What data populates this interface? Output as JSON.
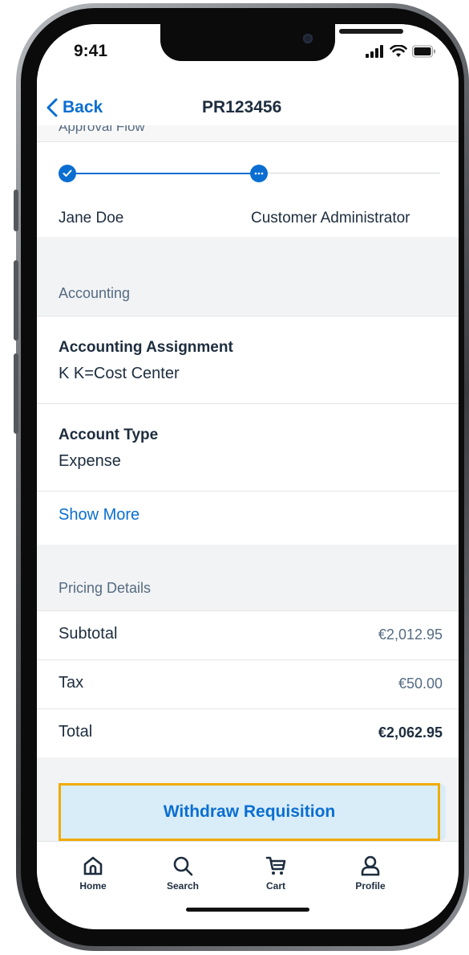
{
  "status": {
    "time": "9:41"
  },
  "nav": {
    "back_label": "Back",
    "title": "PR123456"
  },
  "approval": {
    "header": "Approval Flow",
    "steps": [
      {
        "name": "Jane Doe",
        "state": "completed"
      },
      {
        "name": "Customer Administrator",
        "state": "in-progress"
      }
    ]
  },
  "accounting": {
    "header": "Accounting",
    "fields": [
      {
        "label": "Accounting Assignment",
        "value": "K K=Cost Center"
      },
      {
        "label": "Account Type",
        "value": "Expense"
      }
    ],
    "show_more": "Show More"
  },
  "pricing": {
    "header": "Pricing Details",
    "rows": [
      {
        "label": "Subtotal",
        "value": "€2,012.95"
      },
      {
        "label": "Tax",
        "value": "€50.00"
      },
      {
        "label": "Total",
        "value": "€2,062.95"
      }
    ]
  },
  "action": {
    "withdraw_label": "Withdraw Requisition"
  },
  "tabs": [
    {
      "label": "Home",
      "icon": "home-icon"
    },
    {
      "label": "Search",
      "icon": "search-icon"
    },
    {
      "label": "Cart",
      "icon": "cart-icon"
    },
    {
      "label": "Profile",
      "icon": "profile-icon"
    }
  ],
  "colors": {
    "accent": "#0a6ed1",
    "highlight": "#f0ab00",
    "button_bg": "#d9edf9"
  }
}
